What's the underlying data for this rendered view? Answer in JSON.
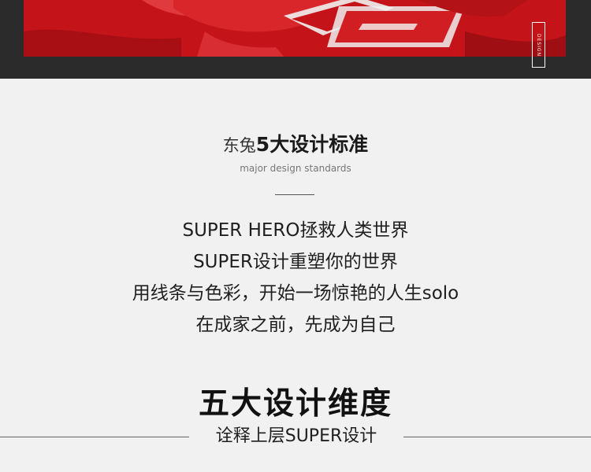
{
  "hero": {
    "tag": "DESIGN"
  },
  "section": {
    "brand": "东兔",
    "title": "5大设计标准",
    "subtitle": "major design standards"
  },
  "slogans": [
    "SUPER HERO拯救人类世界",
    "SUPER设计重塑你的世界",
    "用线条与色彩，开始一场惊艳的人生solo",
    "在成家之前，先成为自己"
  ],
  "dimensions": {
    "title": "五大设计维度",
    "subtitle": "诠释上层SUPER设计"
  },
  "colors": {
    "top_band": "#2b2b2b",
    "hero_red": "#c8161b",
    "background": "#f1f1f1",
    "text_dark": "#1a1a1a"
  }
}
